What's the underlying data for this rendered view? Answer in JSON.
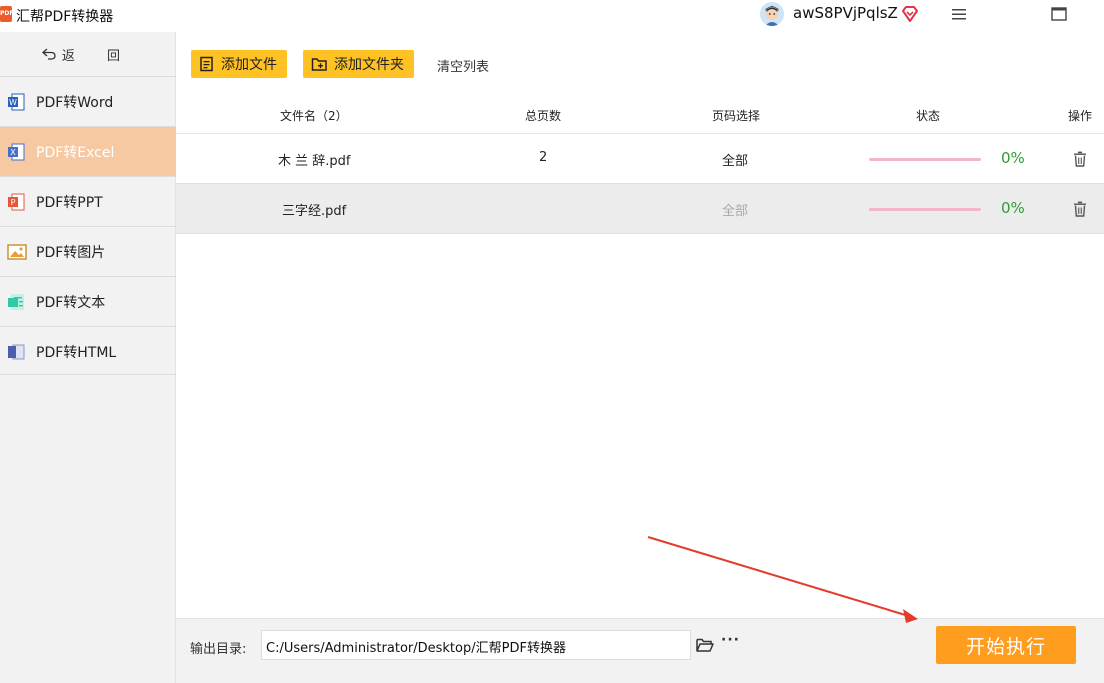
{
  "app": {
    "title": "汇帮PDF转换器",
    "logo_text": "PDF"
  },
  "user": {
    "name": "awS8PVjPqlsZ"
  },
  "sidebar": {
    "back_label": "返 回",
    "items": [
      {
        "label": "PDF转Word",
        "icon": "word-icon",
        "color": "#2b5fb9"
      },
      {
        "label": "PDF转Excel",
        "icon": "excel-icon",
        "color": "#1f7a44"
      },
      {
        "label": "PDF转PPT",
        "icon": "ppt-icon",
        "color": "#e5573a"
      },
      {
        "label": "PDF转图片",
        "icon": "image-icon",
        "color": "#e5a03a"
      },
      {
        "label": "PDF转文本",
        "icon": "text-icon",
        "color": "#2fc9a5"
      },
      {
        "label": "PDF转HTML",
        "icon": "html-icon",
        "color": "#4a5fa8"
      }
    ],
    "active_index": 1
  },
  "toolbar": {
    "add_file": "添加文件",
    "add_folder": "添加文件夹",
    "clear_list": "清空列表"
  },
  "table": {
    "headers": {
      "filename": "文件名（2）",
      "total_pages": "总页数",
      "page_range": "页码选择",
      "status": "状态",
      "action": "操作"
    },
    "rows": [
      {
        "filename": "木 兰 辞.pdf",
        "pages": "2",
        "range": "全部",
        "progress": 0,
        "progress_text": "0%"
      },
      {
        "filename": "三字经.pdf",
        "pages": "",
        "range": "全部",
        "progress": 0,
        "progress_text": "0%"
      }
    ]
  },
  "footer": {
    "output_label": "输出目录:",
    "output_path": "C:/Users/Administrator/Desktop/汇帮PDF转换器",
    "more": "···",
    "start": "开始执行"
  },
  "colors": {
    "accent_yellow": "#ffc224",
    "start_orange": "#ff9d1e",
    "active_item": "#f7c9a3",
    "progress_green": "#2e9e2e",
    "arrow_red": "#e53b2c"
  }
}
